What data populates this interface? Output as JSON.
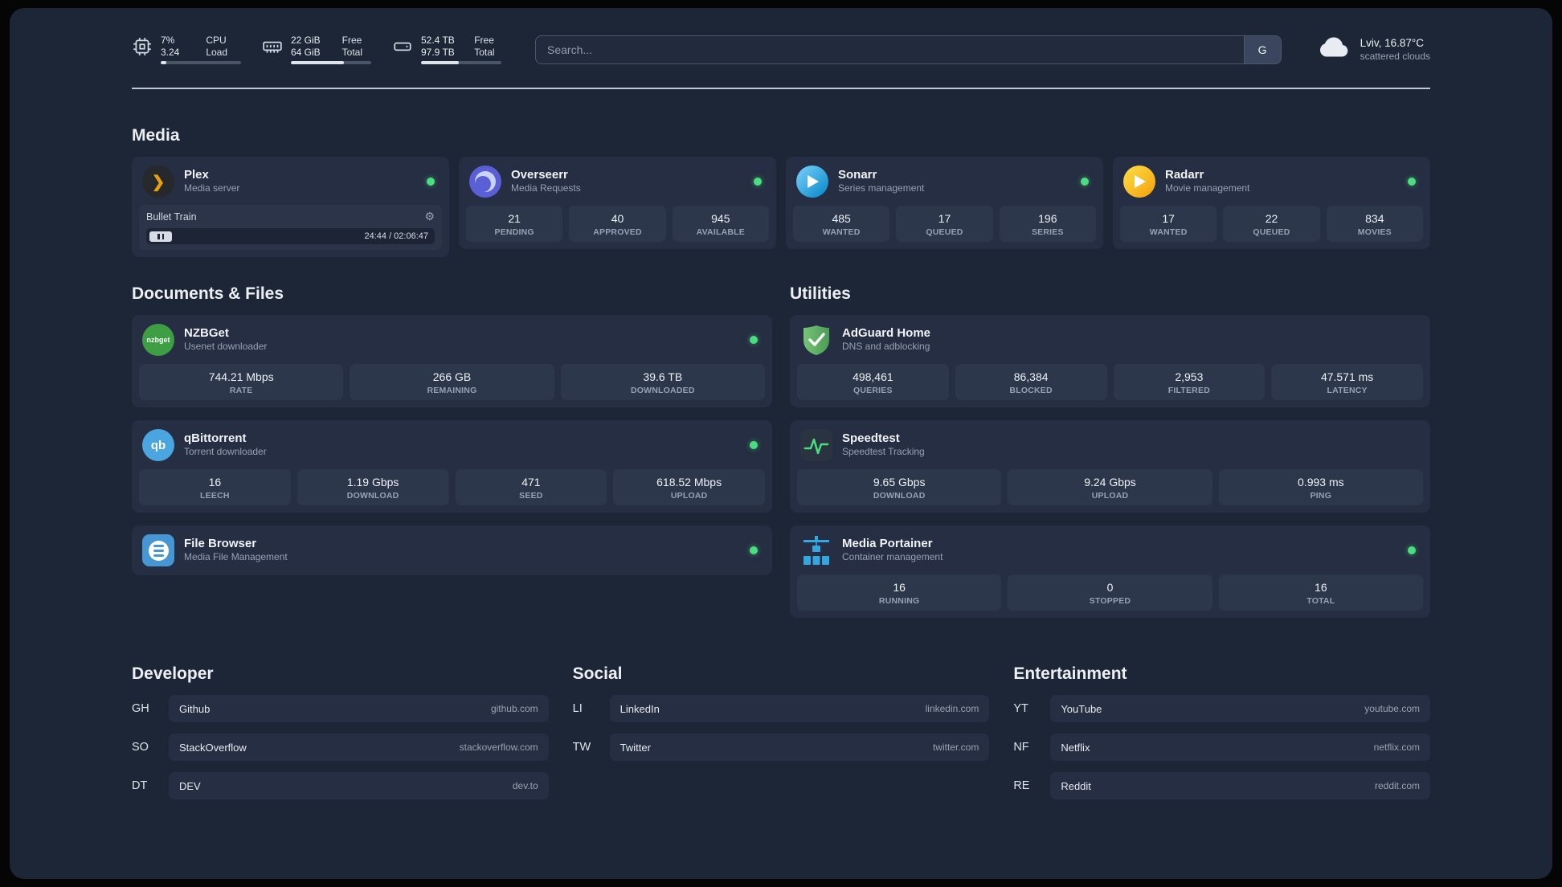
{
  "colors": {
    "status_online": "#4ade80",
    "plex_accent": "#e5a00d"
  },
  "icons": {
    "gear": "⚙",
    "plex_glyph": "❯",
    "nzbget_text": "nzbget",
    "qbittorrent_text": "qb"
  },
  "topbar": {
    "cpu": {
      "value1": "7%",
      "value2": "3.24",
      "label1": "CPU",
      "label2": "Load",
      "bar": 7
    },
    "ram": {
      "value1": "22 GiB",
      "value2": "64 GiB",
      "label1": "Free",
      "label2": "Total",
      "bar": 66
    },
    "disk": {
      "value1": "52.4 TB",
      "value2": "97.9 TB",
      "label1": "Free",
      "label2": "Total",
      "bar": 47
    },
    "search": {
      "placeholder": "Search...",
      "provider_label": "G"
    },
    "weather": {
      "location": "Lviv, 16.87°C",
      "condition": "scattered clouds"
    }
  },
  "media": {
    "title": "Media",
    "plex": {
      "name": "Plex",
      "subtitle": "Media server",
      "now_playing": "Bullet Train",
      "time": "24:44 / 02:06:47"
    },
    "overseerr": {
      "name": "Overseerr",
      "subtitle": "Media Requests",
      "stats": [
        {
          "value": "21",
          "label": "PENDING"
        },
        {
          "value": "40",
          "label": "APPROVED"
        },
        {
          "value": "945",
          "label": "AVAILABLE"
        }
      ]
    },
    "sonarr": {
      "name": "Sonarr",
      "subtitle": "Series management",
      "stats": [
        {
          "value": "485",
          "label": "WANTED"
        },
        {
          "value": "17",
          "label": "QUEUED"
        },
        {
          "value": "196",
          "label": "SERIES"
        }
      ]
    },
    "radarr": {
      "name": "Radarr",
      "subtitle": "Movie management",
      "stats": [
        {
          "value": "17",
          "label": "WANTED"
        },
        {
          "value": "22",
          "label": "QUEUED"
        },
        {
          "value": "834",
          "label": "MOVIES"
        }
      ]
    }
  },
  "documents": {
    "title": "Documents & Files",
    "nzbget": {
      "name": "NZBGet",
      "subtitle": "Usenet downloader",
      "stats": [
        {
          "value": "744.21 Mbps",
          "label": "RATE"
        },
        {
          "value": "266 GB",
          "label": "REMAINING"
        },
        {
          "value": "39.6 TB",
          "label": "DOWNLOADED"
        }
      ]
    },
    "qbittorrent": {
      "name": "qBittorrent",
      "subtitle": "Torrent downloader",
      "stats": [
        {
          "value": "16",
          "label": "LEECH"
        },
        {
          "value": "1.19 Gbps",
          "label": "DOWNLOAD"
        },
        {
          "value": "471",
          "label": "SEED"
        },
        {
          "value": "618.52 Mbps",
          "label": "UPLOAD"
        }
      ]
    },
    "filebrowser": {
      "name": "File Browser",
      "subtitle": "Media File Management"
    }
  },
  "utilities": {
    "title": "Utilities",
    "adguard": {
      "name": "AdGuard Home",
      "subtitle": "DNS and adblocking",
      "stats": [
        {
          "value": "498,461",
          "label": "QUERIES"
        },
        {
          "value": "86,384",
          "label": "BLOCKED"
        },
        {
          "value": "2,953",
          "label": "FILTERED"
        },
        {
          "value": "47.571 ms",
          "label": "LATENCY"
        }
      ]
    },
    "speedtest": {
      "name": "Speedtest",
      "subtitle": "Speedtest Tracking",
      "stats": [
        {
          "value": "9.65 Gbps",
          "label": "DOWNLOAD"
        },
        {
          "value": "9.24 Gbps",
          "label": "UPLOAD"
        },
        {
          "value": "0.993 ms",
          "label": "PING"
        }
      ]
    },
    "portainer": {
      "name": "Media Portainer",
      "subtitle": "Container management",
      "stats": [
        {
          "value": "16",
          "label": "RUNNING"
        },
        {
          "value": "0",
          "label": "STOPPED"
        },
        {
          "value": "16",
          "label": "TOTAL"
        }
      ]
    }
  },
  "bookmarks": {
    "developer": {
      "title": "Developer",
      "items": [
        {
          "abbr": "GH",
          "name": "Github",
          "url": "github.com"
        },
        {
          "abbr": "SO",
          "name": "StackOverflow",
          "url": "stackoverflow.com"
        },
        {
          "abbr": "DT",
          "name": "DEV",
          "url": "dev.to"
        }
      ]
    },
    "social": {
      "title": "Social",
      "items": [
        {
          "abbr": "LI",
          "name": "LinkedIn",
          "url": "linkedin.com"
        },
        {
          "abbr": "TW",
          "name": "Twitter",
          "url": "twitter.com"
        }
      ]
    },
    "entertainment": {
      "title": "Entertainment",
      "items": [
        {
          "abbr": "YT",
          "name": "YouTube",
          "url": "youtube.com"
        },
        {
          "abbr": "NF",
          "name": "Netflix",
          "url": "netflix.com"
        },
        {
          "abbr": "RE",
          "name": "Reddit",
          "url": "reddit.com"
        }
      ]
    }
  }
}
